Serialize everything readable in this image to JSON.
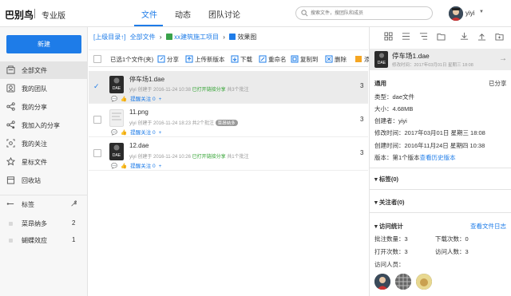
{
  "header": {
    "logo": "巴别鸟",
    "edition": "专业版",
    "tabs": [
      "文件",
      "动态",
      "团队讨论"
    ],
    "search_placeholder": "搜索文件，搜团队和成员",
    "user": "yiyi",
    "accent": "#1e7ce8"
  },
  "sidebar": {
    "new_label": "新建",
    "items": [
      {
        "label": "全部文件",
        "icon": "files-icon"
      },
      {
        "label": "我的团队",
        "icon": "team-icon"
      },
      {
        "label": "我的分享",
        "icon": "share-icon"
      },
      {
        "label": "我加入的分享",
        "icon": "joined-share-icon"
      },
      {
        "label": "我的关注",
        "icon": "follow-icon"
      },
      {
        "label": "星标文件",
        "icon": "star-icon"
      },
      {
        "label": "回收站",
        "icon": "trash-icon"
      }
    ],
    "tags_label": "标签",
    "tags": [
      {
        "name": "菜昂纳多",
        "count": "2"
      },
      {
        "name": "蝴蝶效应",
        "count": "1"
      }
    ]
  },
  "breadcrumb": {
    "up": "[上级目录↑]",
    "all": "全部文件",
    "project": "xx建筑施工项目",
    "current": "效果图"
  },
  "toolbar": {
    "selected": "已选1个文件(夹)",
    "share": "分享",
    "upload_version": "上传新版本",
    "download": "下载",
    "rename": "重命名",
    "copy_to": "复制到",
    "delete": "删除",
    "more": "添"
  },
  "files": [
    {
      "name": "停车场1.dae",
      "thumb": "DAE",
      "meta_user": "yiyi 创建于 2016-11-24 10:38",
      "share": "已打开链接分享",
      "comments": "共3个批注",
      "tag": "",
      "remind": "提醒关注 0",
      "num": "3"
    },
    {
      "name": "11.png",
      "thumb": "",
      "meta_user": "yiyi 创建于 2016-11-24 18:23",
      "share": "",
      "comments": "共2个批注",
      "tag": "菜昂纳多",
      "remind": "提醒关注 0",
      "num": "3"
    },
    {
      "name": "12.dae",
      "thumb": "DAE",
      "meta_user": "yiyi 创建于 2016-11-24 10:26",
      "share": "已打开链接分享",
      "comments": "共1个批注",
      "tag": "",
      "remind": "提醒关注 0",
      "num": "3"
    }
  ],
  "details": {
    "name": "停车场1.dae",
    "sub": "修改时间：2017年03月01日 星期三 18:08",
    "section_general": "通用",
    "shared": "已分享",
    "type": "类型：dae文件",
    "size": "大小：4.68MB",
    "creator": "创建者：yiyi",
    "modified": "修改时间：2017年03月01日 星期三 18:08",
    "created": "创建时间：2016年11月24日 星期四 10:38",
    "version": "版本：第1个版本",
    "version_link": "查看历史版本",
    "tags_section": "标签(0)",
    "followers_section": "关注者(0)",
    "stats_section": "访问统计",
    "log_link": "查看文件日志",
    "comments_count": "批注数量：3",
    "download_count": "下载次数：0",
    "open_count": "打开次数：3",
    "visitor_count": "访问人数：3",
    "visitors_label": "访问人员："
  }
}
